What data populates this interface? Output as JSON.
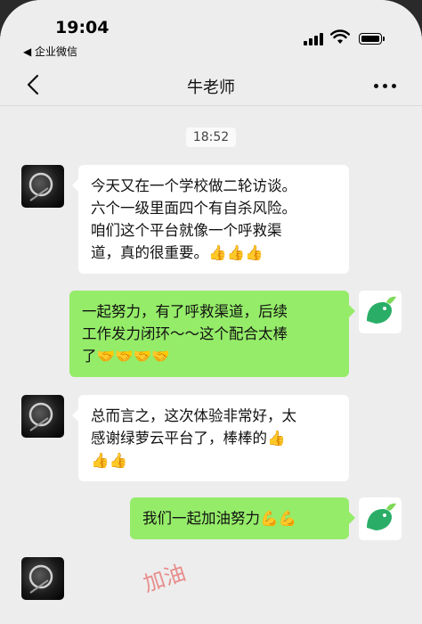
{
  "status_bar": {
    "time": "19:04",
    "back_app": "◀ 企业微信"
  },
  "nav": {
    "title": "牛老师"
  },
  "chat": {
    "timestamp": "18:52",
    "messages": [
      {
        "side": "left",
        "avatar": "dark-circle-avatar",
        "lines": [
          "今天又在一个学校做二轮访谈。",
          "六个一级里面四个有自杀风险。",
          "咱们这个平台就像一个呼救渠",
          "道，真的很重要。👍👍👍"
        ]
      },
      {
        "side": "right",
        "avatar": "green-bird-avatar",
        "lines": [
          "一起努力，有了呼救渠道，后续",
          "工作发力闭环～～这个配合太棒",
          "了🤝🤝🤝🤝"
        ]
      },
      {
        "side": "left",
        "avatar": "dark-circle-avatar",
        "lines": [
          "总而言之，这次体验非常好，太",
          "感谢绿萝云平台了，棒棒的👍",
          "👍👍"
        ]
      },
      {
        "side": "right",
        "avatar": "green-bird-avatar",
        "lines": [
          "我们一起加油努力💪💪"
        ]
      }
    ]
  },
  "watermark": "加油",
  "colors": {
    "background": "#ededed",
    "bubble_left": "#ffffff",
    "bubble_right": "#95ec69",
    "accent_green": "#2aae67"
  }
}
